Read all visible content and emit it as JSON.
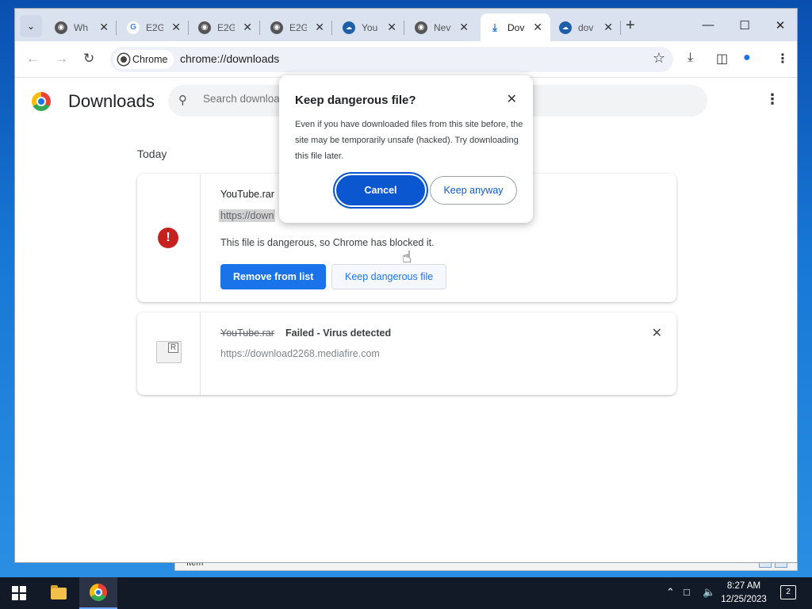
{
  "browser": {
    "tabs": [
      {
        "label": "Wh",
        "icon": "chrome-icon"
      },
      {
        "label": "E2G",
        "icon": "google-icon"
      },
      {
        "label": "E2G",
        "icon": "globe-icon"
      },
      {
        "label": "E2G",
        "icon": "globe-icon"
      },
      {
        "label": "You",
        "icon": "cloud-icon"
      },
      {
        "label": "Nev",
        "icon": "chrome-icon"
      },
      {
        "label": "Dov",
        "icon": "download-icon",
        "active": true
      },
      {
        "label": "dov",
        "icon": "cloud-icon"
      }
    ],
    "omnibox": {
      "chip_label": "Chrome",
      "url": "chrome://downloads"
    }
  },
  "downloads_page": {
    "title": "Downloads",
    "search_placeholder": "Search downloads",
    "section_label": "Today",
    "items": [
      {
        "file_name": "YouTube.rar",
        "url_partial": "https://down",
        "message": "This file is dangerous, so Chrome has blocked it.",
        "remove_label": "Remove from list",
        "keep_label": "Keep dangerous file"
      },
      {
        "file_name": "YouTube.rar",
        "status": "Failed - Virus detected",
        "url": "https://download2268.mediafire.com"
      }
    ]
  },
  "dialog": {
    "title": "Keep dangerous file?",
    "body": "Even if you have downloaded files from this site before, the site may be temporarily unsafe (hacked). Try downloading this file later.",
    "cancel_label": "Cancel",
    "keep_label": "Keep anyway"
  },
  "background_window": {
    "label": "Item"
  },
  "taskbar": {
    "time": "8:27 AM",
    "date": "12/25/2023",
    "notification_count": "2"
  },
  "colors": {
    "accent": "#1a73e8",
    "danger": "#c5221f",
    "dialog_primary": "#0b57d0"
  }
}
